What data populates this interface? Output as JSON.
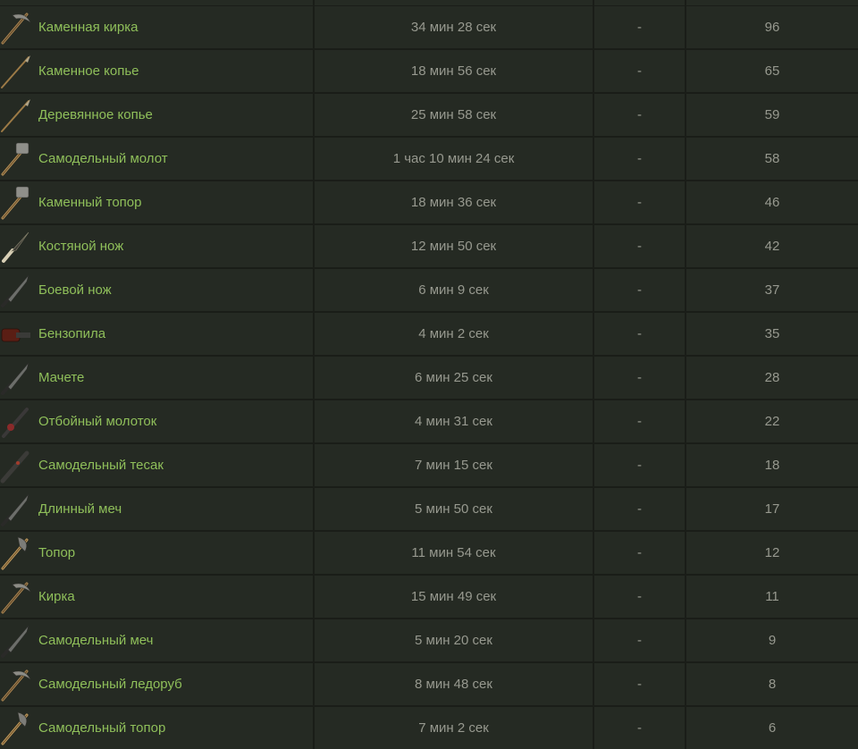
{
  "rows": [
    {
      "name": "Каменная кирка",
      "time": "34 мин 28 сек",
      "dash": "-",
      "value": "96",
      "icon": "stone-pickaxe-icon"
    },
    {
      "name": "Каменное копье",
      "time": "18 мин 56 сек",
      "dash": "-",
      "value": "65",
      "icon": "stone-spear-icon"
    },
    {
      "name": "Деревянное копье",
      "time": "25 мин 58 сек",
      "dash": "-",
      "value": "59",
      "icon": "wooden-spear-icon"
    },
    {
      "name": "Самодельный молот",
      "time": "1 час 10 мин 24 сек",
      "dash": "-",
      "value": "58",
      "icon": "salvaged-hammer-icon"
    },
    {
      "name": "Каменный топор",
      "time": "18 мин 36 сек",
      "dash": "-",
      "value": "46",
      "icon": "stone-hatchet-icon"
    },
    {
      "name": "Костяной нож",
      "time": "12 мин 50 сек",
      "dash": "-",
      "value": "42",
      "icon": "bone-knife-icon"
    },
    {
      "name": "Боевой нож",
      "time": "6 мин 9 сек",
      "dash": "-",
      "value": "37",
      "icon": "combat-knife-icon"
    },
    {
      "name": "Бензопила",
      "time": "4 мин 2 сек",
      "dash": "-",
      "value": "35",
      "icon": "chainsaw-icon"
    },
    {
      "name": "Мачете",
      "time": "6 мин 25 сек",
      "dash": "-",
      "value": "28",
      "icon": "machete-icon"
    },
    {
      "name": "Отбойный молоток",
      "time": "4 мин 31 сек",
      "dash": "-",
      "value": "22",
      "icon": "jackhammer-icon"
    },
    {
      "name": "Самодельный тесак",
      "time": "7 мин 15 сек",
      "dash": "-",
      "value": "18",
      "icon": "salvaged-cleaver-icon"
    },
    {
      "name": "Длинный меч",
      "time": "5 мин 50 сек",
      "dash": "-",
      "value": "17",
      "icon": "longsword-icon"
    },
    {
      "name": "Топор",
      "time": "11 мин 54 сек",
      "dash": "-",
      "value": "12",
      "icon": "hatchet-icon"
    },
    {
      "name": "Кирка",
      "time": "15 мин 49 сек",
      "dash": "-",
      "value": "11",
      "icon": "pickaxe-icon"
    },
    {
      "name": "Самодельный меч",
      "time": "5 мин 20 сек",
      "dash": "-",
      "value": "9",
      "icon": "salvaged-sword-icon"
    },
    {
      "name": "Самодельный ледоруб",
      "time": "8 мин 48 сек",
      "dash": "-",
      "value": "8",
      "icon": "salvaged-icepick-icon"
    },
    {
      "name": "Самодельный топор",
      "time": "7 мин 2 сек",
      "dash": "-",
      "value": "6",
      "icon": "salvaged-axe-icon"
    }
  ],
  "colors": {
    "background": "#1c1f1b",
    "row": "#252a23",
    "link": "#8fbf5a",
    "text": "#97998f"
  }
}
